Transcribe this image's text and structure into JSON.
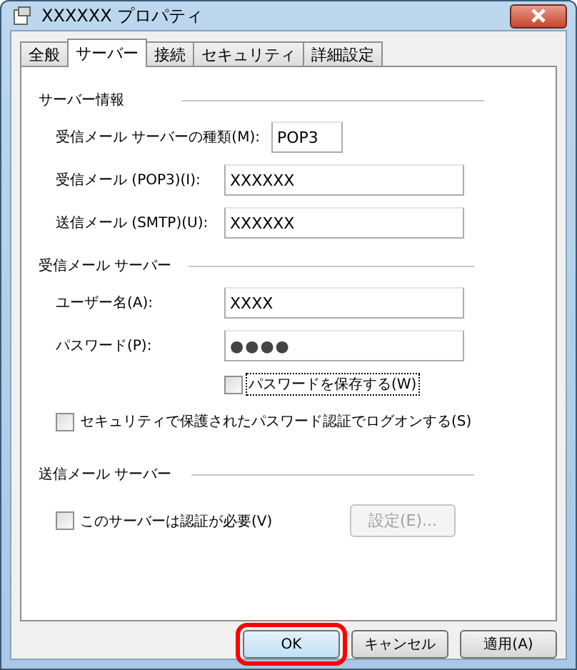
{
  "window": {
    "title": "XXXXXX プロパティ"
  },
  "tabs": [
    {
      "label": "全般",
      "selected": false
    },
    {
      "label": "サーバー",
      "selected": true
    },
    {
      "label": "接続",
      "selected": false
    },
    {
      "label": "セキュリティ",
      "selected": false
    },
    {
      "label": "詳細設定",
      "selected": false
    }
  ],
  "server_info": {
    "heading": "サーバー情報",
    "fields": [
      {
        "label": "受信メール サーバーの種類(M):",
        "value": "POP3",
        "kind": "short"
      },
      {
        "label": "受信メール (POP3)(I):",
        "value": "XXXXXX",
        "kind": "wide"
      },
      {
        "label": "送信メール (SMTP)(U):",
        "value": "XXXXXX",
        "kind": "wide"
      }
    ]
  },
  "incoming_server": {
    "heading": "受信メール サーバー",
    "user_name": {
      "label": "ユーザー名(A):",
      "value": "XXXX"
    },
    "password": {
      "label": "パスワード(P):",
      "value": "●●●●"
    },
    "save_password": {
      "label": "パスワードを保存する(W)",
      "checked": false,
      "focused": true
    },
    "secure_auth": {
      "label": "セキュリティで保護されたパスワード認証でログオンする(S)",
      "checked": false
    }
  },
  "outgoing_server": {
    "heading": "送信メール サーバー",
    "auth_required": {
      "label": "このサーバーは認証が必要(V)",
      "checked": false
    },
    "settings_button": {
      "label": "設定(E)...",
      "disabled": true
    }
  },
  "buttons": [
    {
      "label": "OK",
      "highlighted": true
    },
    {
      "label": "キャンセル",
      "highlighted": false
    },
    {
      "label": "適用(A)",
      "highlighted": false
    }
  ]
}
